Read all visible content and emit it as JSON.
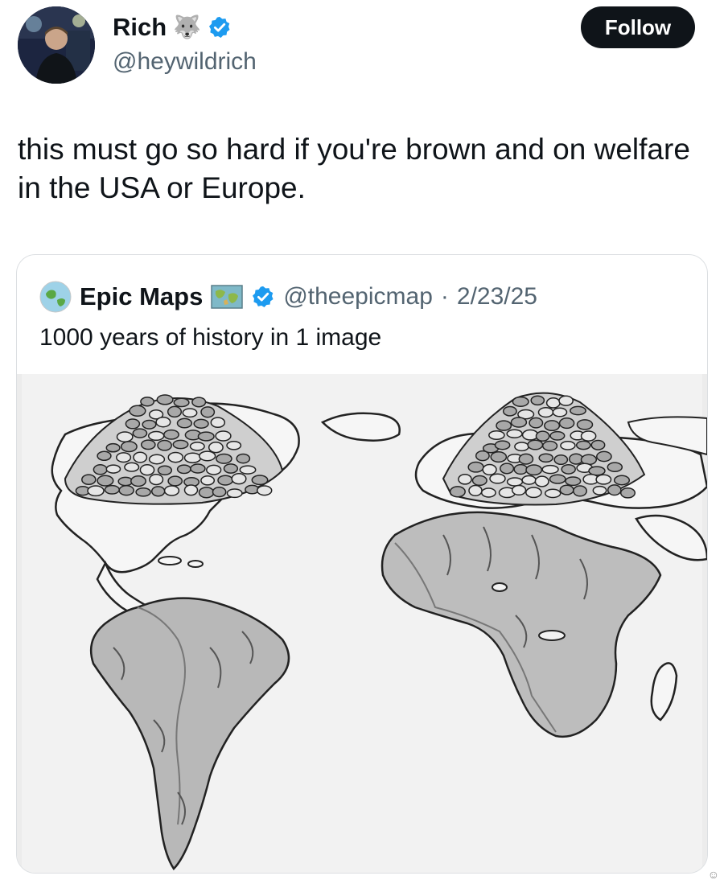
{
  "tweet": {
    "author_name": "Rich",
    "author_handle": "@heywildrich",
    "follow_label": "Follow",
    "name_emoji": "🐺",
    "text": "this must go so hard if you're brown and on welfare in the USA or Europe."
  },
  "quote": {
    "author_name": "Epic Maps",
    "author_handle": "@theepicmap",
    "separator": "·",
    "date": "2/23/25",
    "text": "1000 years of history in 1 image"
  },
  "colors": {
    "verified": "#1d9bf0",
    "follow_bg": "#0f1419",
    "secondary_text": "#536471"
  },
  "icons": [
    "wolf-icon",
    "verified-icon",
    "map-icon",
    "corner-mark-icon"
  ],
  "corner_mark": "☺"
}
